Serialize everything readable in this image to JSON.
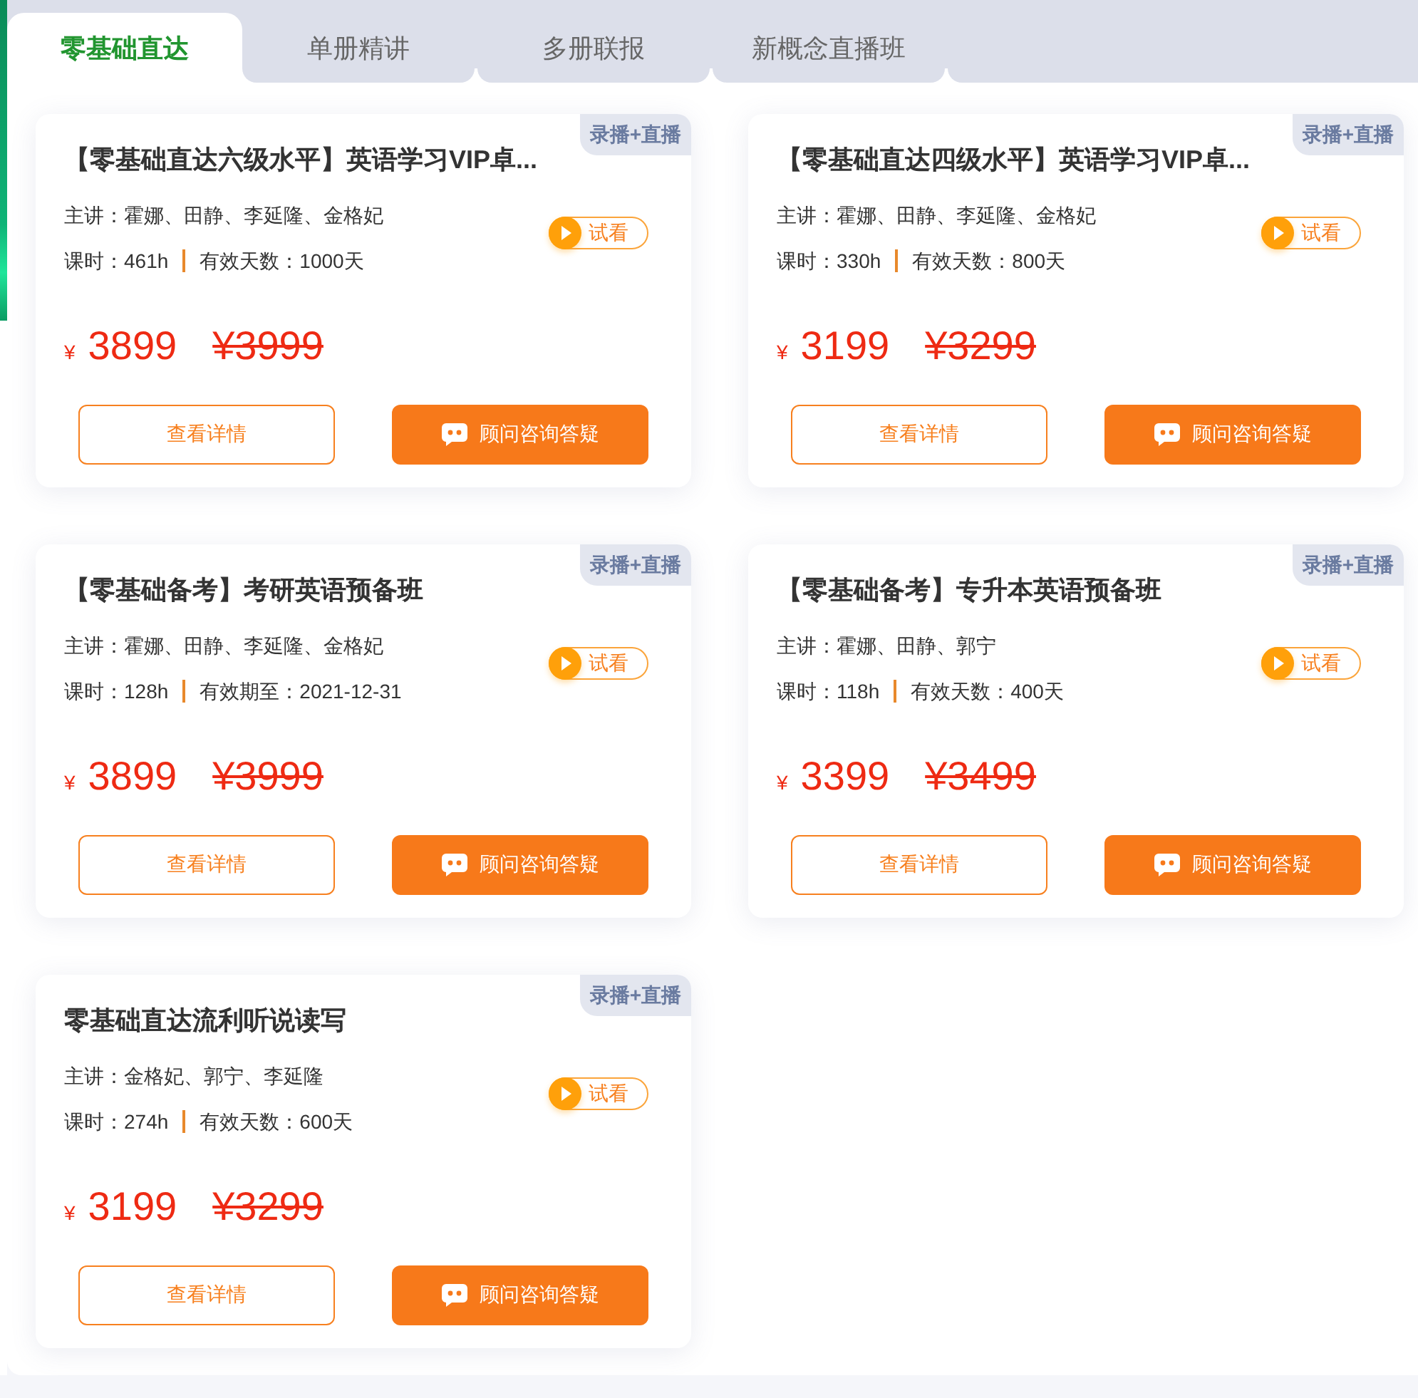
{
  "tabs": [
    {
      "label": "零基础直达",
      "selected": true
    },
    {
      "label": "单册精讲",
      "selected": false
    },
    {
      "label": "多册联报",
      "selected": false
    },
    {
      "label": "新概念直播班",
      "selected": false
    }
  ],
  "courses": [
    {
      "badge": "录播+直播",
      "title": "【零基础直达六级水平】英语学习VIP卓...",
      "teachers": "主讲：霍娜、田静、李延隆、金格妃",
      "hours": "课时：461h",
      "validity": "有效天数：1000天",
      "preview": "试看",
      "currency": "¥",
      "price": "3899",
      "original_price": "¥3999",
      "details_button": "查看详情",
      "consult_button": "顾问咨询答疑"
    },
    {
      "badge": "录播+直播",
      "title": "【零基础直达四级水平】英语学习VIP卓...",
      "teachers": "主讲：霍娜、田静、李延隆、金格妃",
      "hours": "课时：330h",
      "validity": "有效天数：800天",
      "preview": "试看",
      "currency": "¥",
      "price": "3199",
      "original_price": "¥3299",
      "details_button": "查看详情",
      "consult_button": "顾问咨询答疑"
    },
    {
      "badge": "录播+直播",
      "title": "【零基础备考】考研英语预备班",
      "teachers": "主讲：霍娜、田静、李延隆、金格妃",
      "hours": "课时：128h",
      "validity": "有效期至：2021-12-31",
      "preview": "试看",
      "currency": "¥",
      "price": "3899",
      "original_price": "¥3999",
      "details_button": "查看详情",
      "consult_button": "顾问咨询答疑"
    },
    {
      "badge": "录播+直播",
      "title": "【零基础备考】专升本英语预备班",
      "teachers": "主讲：霍娜、田静、郭宁",
      "hours": "课时：118h",
      "validity": "有效天数：400天",
      "preview": "试看",
      "currency": "¥",
      "price": "3399",
      "original_price": "¥3499",
      "details_button": "查看详情",
      "consult_button": "顾问咨询答疑"
    },
    {
      "badge": "录播+直播",
      "title": "零基础直达流利听说读写",
      "teachers": "主讲：金格妃、郭宁、李延隆",
      "hours": "课时：274h",
      "validity": "有效天数：600天",
      "preview": "试看",
      "currency": "¥",
      "price": "3199",
      "original_price": "¥3299",
      "details_button": "查看详情",
      "consult_button": "顾问咨询答疑"
    }
  ]
}
